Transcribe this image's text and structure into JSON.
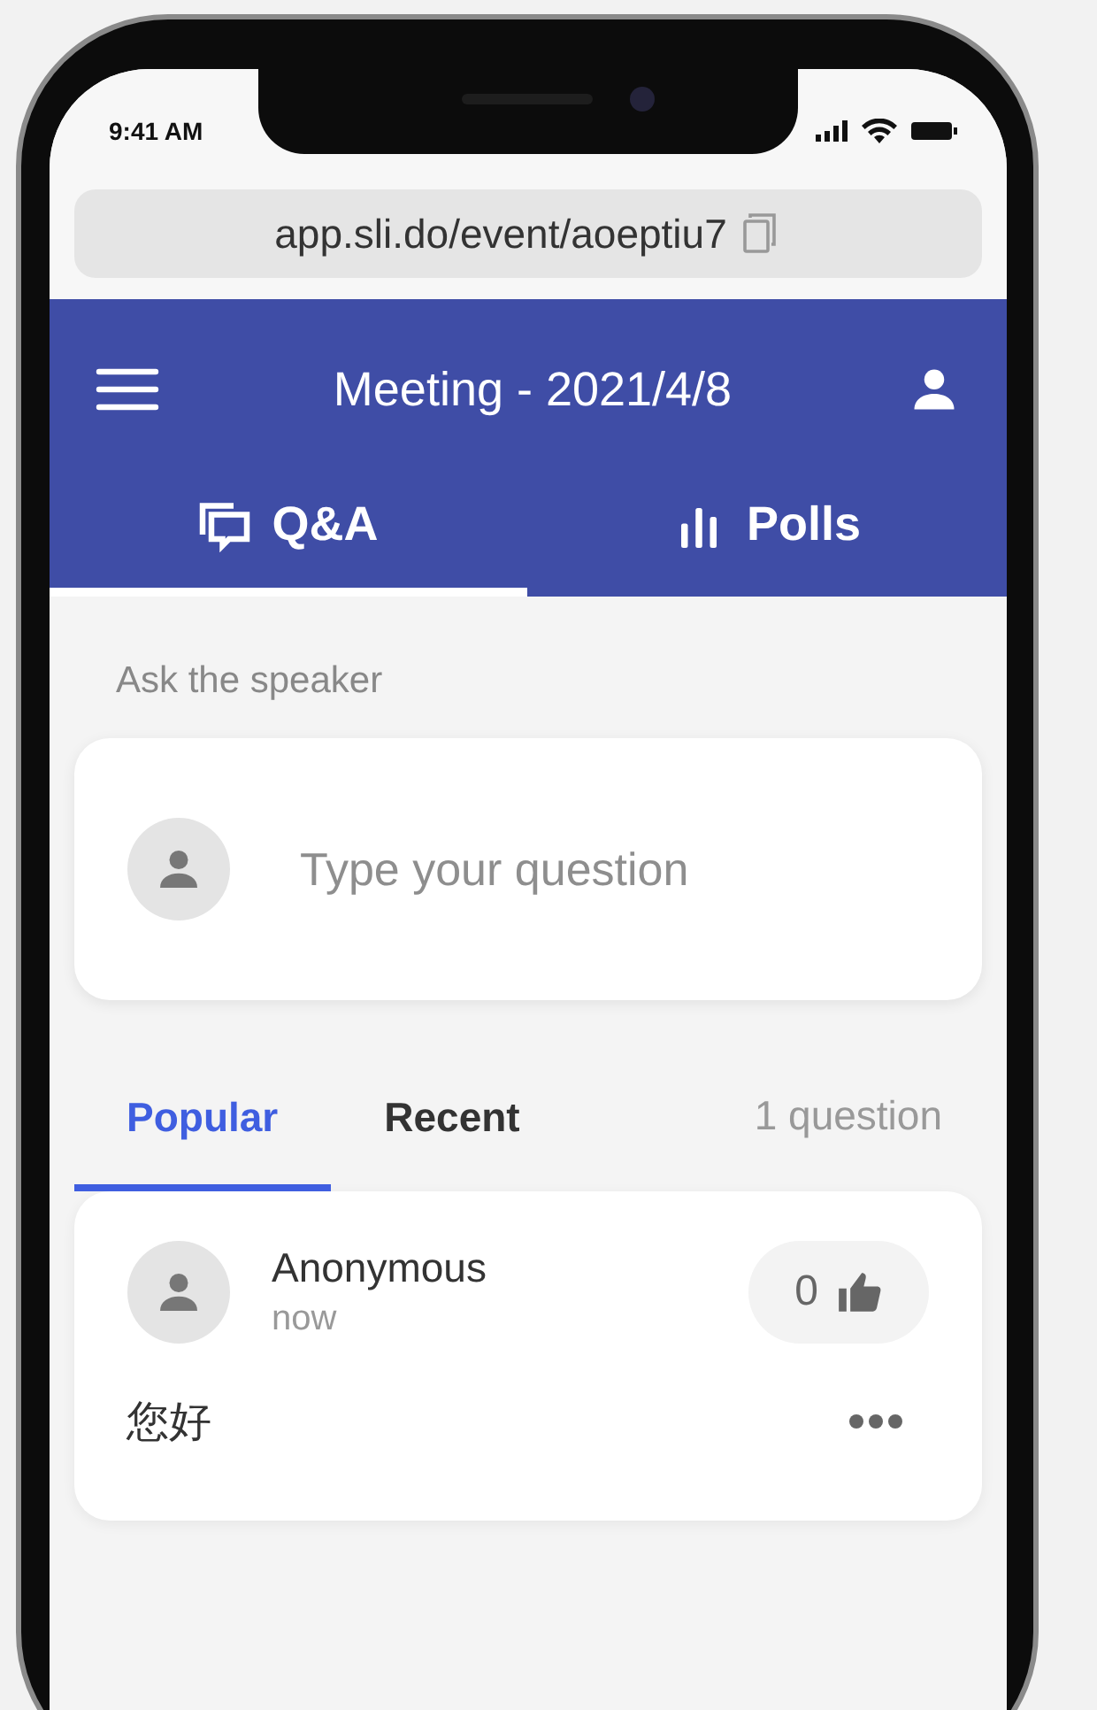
{
  "status_bar": {
    "time": "9:41 AM"
  },
  "address_bar": {
    "url": "app.sli.do/event/aoeptiu7"
  },
  "header": {
    "title": "Meeting - 2021/4/8"
  },
  "tabs": [
    {
      "label": "Q&A",
      "kind": "qa",
      "selected": true
    },
    {
      "label": "Polls",
      "kind": "polls",
      "selected": false
    }
  ],
  "ask": {
    "label": "Ask the speaker",
    "placeholder": "Type your question"
  },
  "sort_tabs": [
    {
      "label": "Popular",
      "selected": true
    },
    {
      "label": "Recent",
      "selected": false
    }
  ],
  "question_count": "1 question",
  "questions": [
    {
      "author": "Anonymous",
      "time": "now",
      "likes": "0",
      "text": "您好"
    }
  ]
}
